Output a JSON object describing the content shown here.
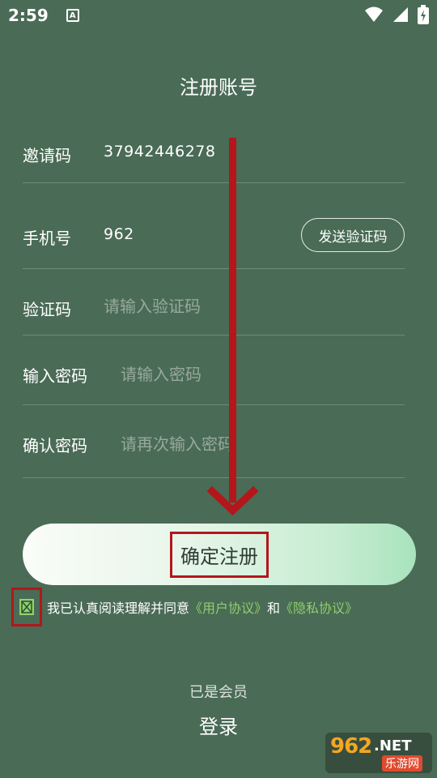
{
  "status_bar": {
    "time": "2:59",
    "app_icon_letter": "A",
    "icons": [
      "wifi-icon",
      "signal-icon",
      "battery-icon"
    ]
  },
  "page": {
    "title": "注册账号"
  },
  "form": {
    "invite_code": {
      "label": "邀请码",
      "value": "37942446278"
    },
    "phone": {
      "label": "手机号",
      "value": "962",
      "send_code_label": "发送验证码"
    },
    "verify_code": {
      "label": "验证码",
      "placeholder": "请输入验证码"
    },
    "password": {
      "label": "输入密码",
      "placeholder": "请输入密码"
    },
    "confirm_password": {
      "label": "确认密码",
      "placeholder": "请再次输入密码"
    }
  },
  "submit": {
    "label": "确定注册"
  },
  "agreement": {
    "prefix": "我已认真阅读理解并同意",
    "user_agreement": "《用户协议》",
    "conjunction": "和",
    "privacy_policy": "《隐私协议》",
    "checked": true
  },
  "footer": {
    "member_text": "已是会员",
    "login_label": "登录"
  },
  "watermark": {
    "brand": "962",
    "tld": ".NET",
    "sub": "乐游网"
  },
  "colors": {
    "background": "#4a6b55",
    "accent_green": "#8fcf6e",
    "annotation_red": "#b3161b"
  }
}
